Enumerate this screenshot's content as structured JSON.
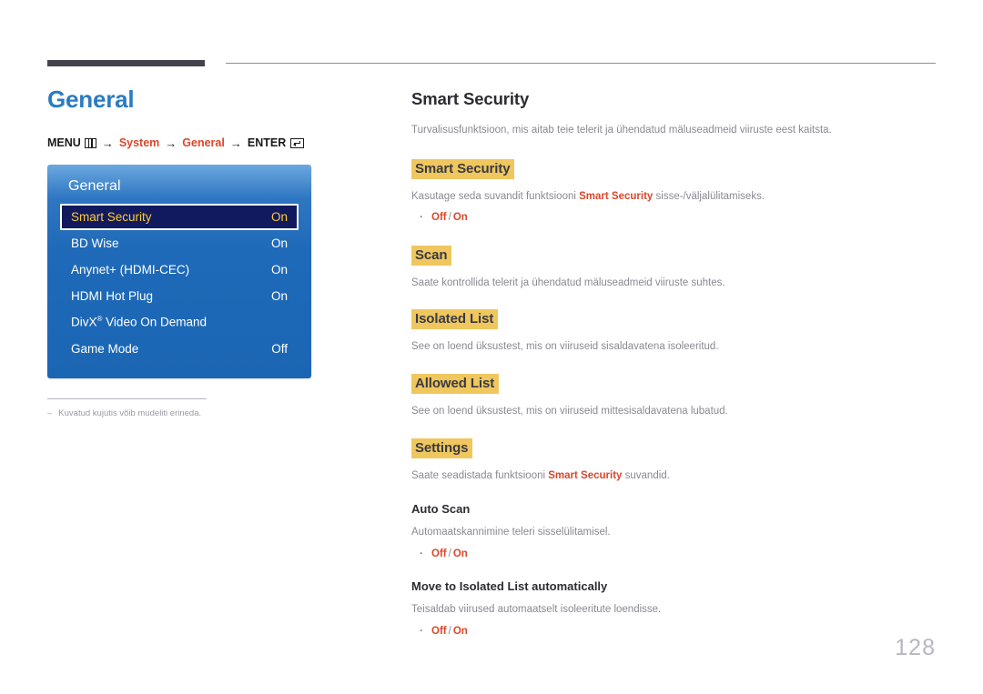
{
  "page": {
    "number": "128"
  },
  "left": {
    "title": "General",
    "breadcrumb": {
      "menu_label": "MENU",
      "menu_icon": "menu-bars-icon",
      "arrow": "→",
      "item1": "System",
      "item2": "General",
      "enter_label": "ENTER",
      "enter_icon": "enter-key-icon"
    },
    "osd": {
      "title": "General",
      "rows": [
        {
          "label": "Smart Security",
          "value": "On",
          "selected": true
        },
        {
          "label": "BD Wise",
          "value": "On",
          "selected": false
        },
        {
          "label": "Anynet+ (HDMI-CEC)",
          "value": "On",
          "selected": false
        },
        {
          "label": "HDMI Hot Plug",
          "value": "On",
          "selected": false
        },
        {
          "label": "DivX® Video On Demand",
          "value": "",
          "selected": false
        },
        {
          "label": "Game Mode",
          "value": "Off",
          "selected": false
        }
      ]
    },
    "footnote": {
      "dash": "–",
      "text": "Kuvatud kujutis võib mudeliti erineda."
    }
  },
  "right": {
    "section_title": "Smart Security",
    "intro": "Turvalisusfunktsioon, mis aitab teie telerit ja ühendatud mäluseadmeid viiruste eest kaitsta.",
    "blocks": [
      {
        "heading": "Smart Security",
        "heading_style": "highlight",
        "desc_pre": "Kasutage seda suvandit funktsiooni ",
        "desc_accent": "Smart Security",
        "desc_post": " sisse-/väljalülitamiseks.",
        "options": {
          "off": "Off",
          "sep": "/",
          "on": "On"
        }
      },
      {
        "heading": "Scan",
        "heading_style": "highlight",
        "desc_pre": "Saate kontrollida telerit ja ühendatud mäluseadmeid viiruste suhtes.",
        "desc_accent": "",
        "desc_post": "",
        "options": null
      },
      {
        "heading": "Isolated List",
        "heading_style": "highlight",
        "desc_pre": "See on loend üksustest, mis on viiruseid sisaldavatena isoleeritud.",
        "desc_accent": "",
        "desc_post": "",
        "options": null
      },
      {
        "heading": "Allowed List",
        "heading_style": "highlight",
        "desc_pre": "See on loend üksustest, mis on viiruseid mittesisaldavatena lubatud.",
        "desc_accent": "",
        "desc_post": "",
        "options": null
      },
      {
        "heading": "Settings",
        "heading_style": "highlight",
        "desc_pre": "Saate seadistada funktsiooni ",
        "desc_accent": "Smart Security",
        "desc_post": " suvandid.",
        "options": null
      },
      {
        "heading": "Auto Scan",
        "heading_style": "plain",
        "desc_pre": "Automaatskannimine teleri sisselülitamisel.",
        "desc_accent": "",
        "desc_post": "",
        "options": {
          "off": "Off",
          "sep": "/",
          "on": "On"
        }
      },
      {
        "heading": "Move to Isolated List automatically",
        "heading_style": "plain",
        "desc_pre": "Teisaldab viirused automaatselt isoleeritute loendisse.",
        "desc_accent": "",
        "desc_post": "",
        "options": {
          "off": "Off",
          "sep": "/",
          "on": "On"
        }
      }
    ]
  },
  "colors": {
    "title_blue": "#2a7cc0",
    "accent_orange": "#d9472b",
    "highlight_yellow": "#efc75e",
    "osd_blue": "#1f6ab8",
    "osd_selected_bg": "#111a5e",
    "osd_selected_text": "#ffcb30",
    "header_bar": "#45424f",
    "muted_text": "#8a8892"
  }
}
